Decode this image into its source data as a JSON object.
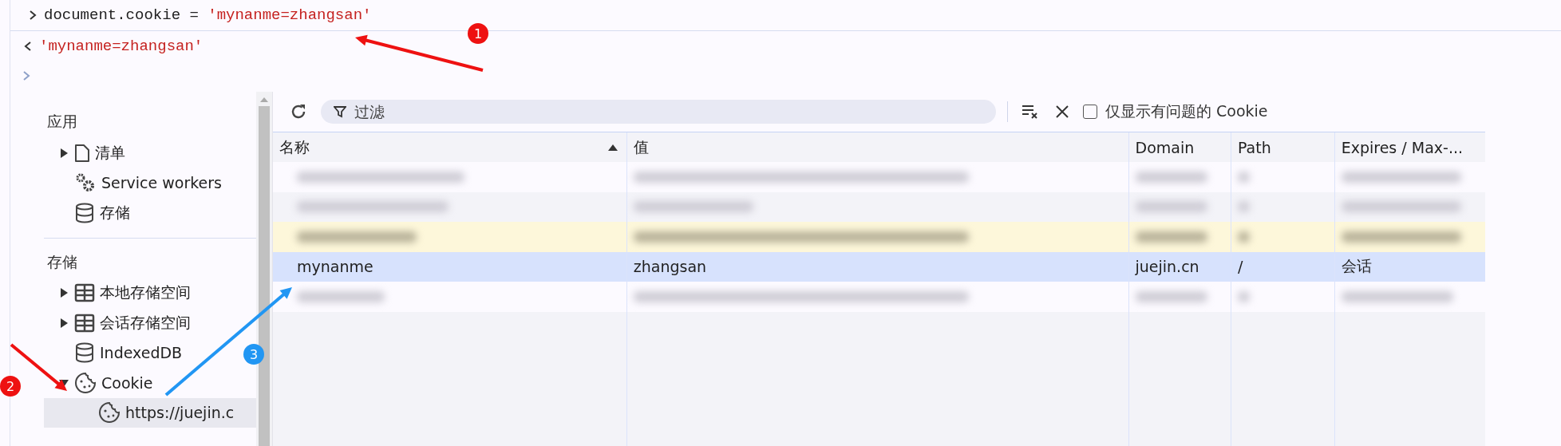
{
  "console": [
    {
      "kind": "input",
      "code": "document.cookie = ",
      "string": "'mynanme=zhangsan'"
    },
    {
      "kind": "result",
      "string": "'mynanme=zhangsan'"
    },
    {
      "kind": "prompt"
    }
  ],
  "sidebar": {
    "sections": [
      {
        "title": "应用",
        "items": [
          {
            "label": "清单",
            "kind": "file",
            "expanded": false,
            "selected": false
          },
          {
            "label": "Service workers",
            "kind": "gears",
            "selected": false
          },
          {
            "label": "存储",
            "kind": "database",
            "selected": false
          }
        ]
      },
      {
        "title": "存储",
        "items": [
          {
            "label": "本地存储空间",
            "kind": "table",
            "expanded": false,
            "selected": false
          },
          {
            "label": "会话存储空间",
            "kind": "table",
            "expanded": false,
            "selected": false
          },
          {
            "label": "IndexedDB",
            "kind": "database",
            "selected": false
          },
          {
            "label": "Cookie",
            "kind": "cookie",
            "expanded": true,
            "selected": false,
            "children": [
              {
                "label": "https://juejin.c",
                "kind": "cookie",
                "selected": true
              }
            ]
          }
        ]
      }
    ]
  },
  "toolbar": {
    "filter": {
      "placeholder": "过滤"
    },
    "only_issues": {
      "label": "仅显示有问题的 Cookie",
      "checked": false
    }
  },
  "table": {
    "columns": [
      {
        "label": "名称",
        "sorted": true
      },
      {
        "label": "值",
        "sorted": false
      },
      {
        "label": "Domain",
        "sorted": false
      },
      {
        "label": "Path",
        "sorted": false
      },
      {
        "label": "Expires / Max-...",
        "sorted": false
      }
    ],
    "rows": [
      {
        "redacted": true,
        "highlighted": false,
        "selected": false
      },
      {
        "redacted": true,
        "highlighted": false,
        "selected": false
      },
      {
        "redacted": true,
        "highlighted": true,
        "selected": false
      },
      {
        "redacted": false,
        "highlighted": false,
        "selected": true,
        "cells": [
          "mynanme",
          "zhangsan",
          "juejin.cn",
          "/",
          "会话"
        ]
      },
      {
        "redacted": true,
        "highlighted": false,
        "selected": false
      }
    ]
  },
  "annotations": [
    {
      "label": "1",
      "color": "#ee1111"
    },
    {
      "label": "2",
      "color": "#ee1111"
    },
    {
      "label": "3",
      "color": "#2196f3"
    }
  ]
}
